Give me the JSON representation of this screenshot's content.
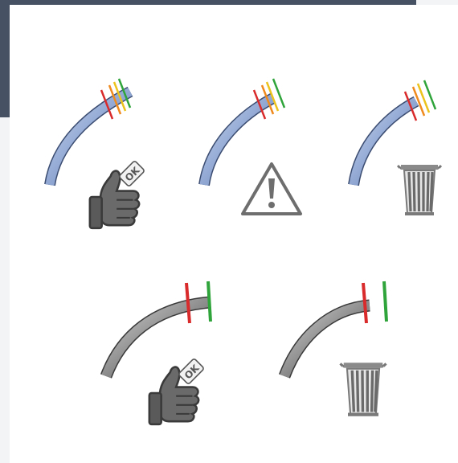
{
  "colors": {
    "header": "#465263",
    "coated_fiber": "#9eb2d6",
    "bare_fiber": "#888888",
    "mark_red": "#d92b2b",
    "mark_orange": "#ef8a1f",
    "mark_yellow": "#ecc21c",
    "mark_green": "#2fa43a",
    "icon_gray": "#6e6e6e"
  },
  "row1": {
    "good": {
      "badge": "OK",
      "icon": "thumbs-up-icon"
    },
    "warning": {
      "icon": "warning-triangle-icon"
    },
    "discard": {
      "icon": "trash-can-icon"
    }
  },
  "row2": {
    "good": {
      "badge": "OK",
      "icon": "thumbs-up-icon"
    },
    "discard": {
      "icon": "trash-can-icon"
    }
  }
}
